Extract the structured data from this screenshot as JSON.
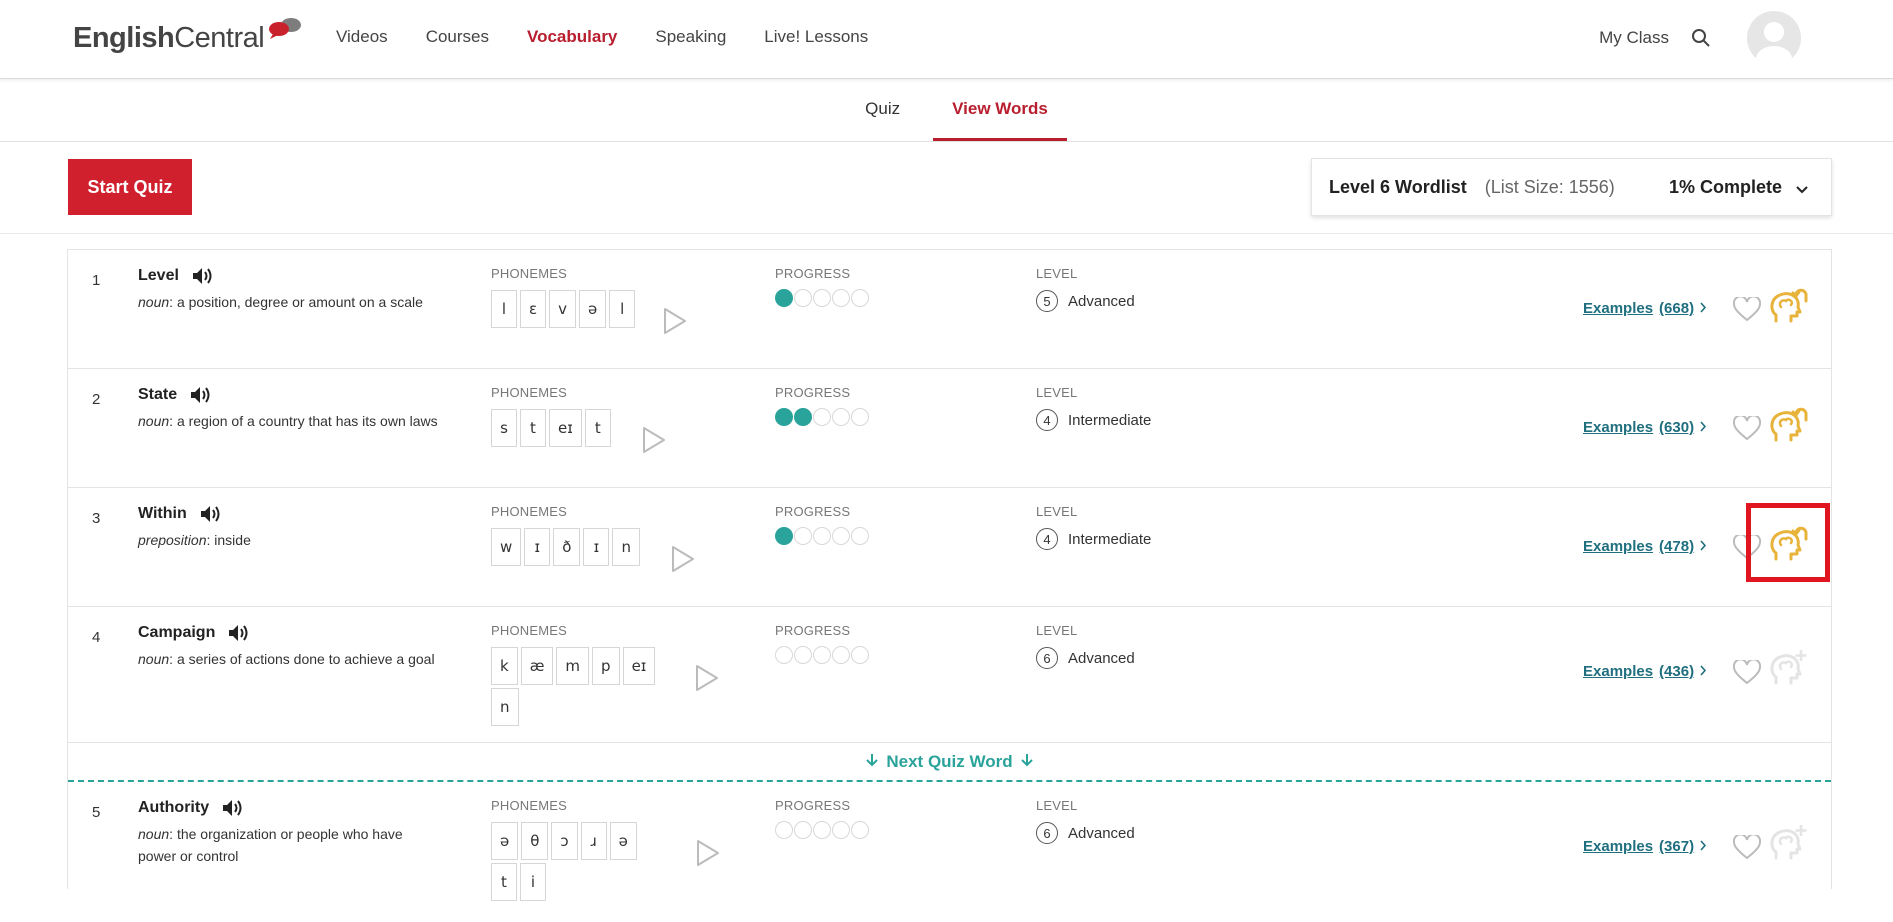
{
  "header": {
    "logo_part1": "English",
    "logo_part2": "Central",
    "nav_items": [
      "Videos",
      "Courses",
      "Vocabulary",
      "Speaking",
      "Live! Lessons"
    ],
    "my_class": "My Class"
  },
  "subtabs": [
    "Quiz",
    "View Words"
  ],
  "toolbar": {
    "start_quiz": "Start Quiz",
    "wordlist_name": "Level 6 Wordlist",
    "list_size": "(List Size: 1556)",
    "complete": "1% Complete"
  },
  "labels": {
    "phonemes": "PHONEMES",
    "progress": "PROGRESS",
    "level": "LEVEL",
    "examples": "Examples"
  },
  "next_quiz_word": "Next Quiz Word",
  "words": [
    {
      "index": "1",
      "word": "Level",
      "pos": "noun",
      "definition": "a position, degree or amount on a scale",
      "phonemes": [
        "l",
        "ɛ",
        "v",
        "ə",
        "l"
      ],
      "progress": 1,
      "level_num": "5",
      "level_name": "Advanced",
      "examples": "(668)",
      "learned": true
    },
    {
      "index": "2",
      "word": "State",
      "pos": "noun",
      "definition": "a region of a country that has its own laws",
      "phonemes": [
        "s",
        "t",
        "eɪ",
        "t"
      ],
      "progress": 2,
      "level_num": "4",
      "level_name": "Intermediate",
      "examples": "(630)",
      "learned": true
    },
    {
      "index": "3",
      "word": "Within",
      "pos": "preposition",
      "definition": "inside",
      "phonemes": [
        "w",
        "ɪ",
        "ð",
        "ɪ",
        "n"
      ],
      "progress": 1,
      "level_num": "4",
      "level_name": "Intermediate",
      "examples": "(478)",
      "learned": true
    },
    {
      "index": "4",
      "word": "Campaign",
      "pos": "noun",
      "definition": "a series of actions done to achieve a goal",
      "phonemes": [
        "k",
        "æ",
        "m",
        "p",
        "eɪ",
        "n"
      ],
      "progress": 0,
      "level_num": "6",
      "level_name": "Advanced",
      "examples": "(436)",
      "learned": false
    },
    {
      "index": "5",
      "word": "Authority",
      "pos": "noun",
      "definition": "the organization or people who have power or control",
      "phonemes": [
        "ə",
        "θ",
        "ɔ",
        "ɹ",
        "ə",
        "t",
        "i"
      ],
      "progress": 0,
      "level_num": "6",
      "level_name": "Advanced",
      "examples": "(367)",
      "learned": false
    }
  ],
  "colors": {
    "brand_red": "#d0202e",
    "active_red": "#b81e2e",
    "teal": "#2aa39b",
    "link_teal": "#1f6f7f",
    "gold": "#e8b33a",
    "highlight": "#e0151f"
  }
}
